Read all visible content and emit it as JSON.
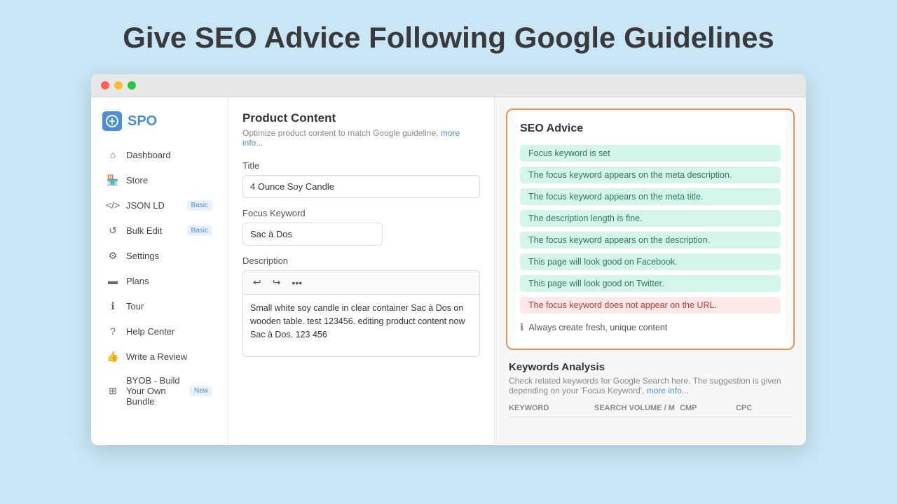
{
  "page": {
    "title": "Give SEO Advice Following Google Guidelines"
  },
  "browser": {
    "traffic_lights": [
      "red",
      "yellow",
      "green"
    ]
  },
  "sidebar": {
    "logo_text": "SPO",
    "items": [
      {
        "id": "dashboard",
        "label": "Dashboard",
        "icon": "home",
        "badge": null
      },
      {
        "id": "store",
        "label": "Store",
        "icon": "store",
        "badge": null
      },
      {
        "id": "json-ld",
        "label": "JSON LD",
        "icon": "code",
        "badge": "Basic"
      },
      {
        "id": "bulk-edit",
        "label": "Bulk Edit",
        "icon": "edit",
        "badge": "Basic"
      },
      {
        "id": "settings",
        "label": "Settings",
        "icon": "gear",
        "badge": null
      },
      {
        "id": "plans",
        "label": "Plans",
        "icon": "card",
        "badge": null
      },
      {
        "id": "tour",
        "label": "Tour",
        "icon": "info-circle",
        "badge": null
      },
      {
        "id": "help-center",
        "label": "Help Center",
        "icon": "help-circle",
        "badge": null
      },
      {
        "id": "write-review",
        "label": "Write a Review",
        "icon": "thumb-up",
        "badge": null
      },
      {
        "id": "byob",
        "label": "BYOB - Build Your Own Bundle",
        "icon": "bundle",
        "badge": "New"
      }
    ]
  },
  "product_panel": {
    "title": "Product Content",
    "subtitle": "Optimize product content to match Google guideline,",
    "more_info_link": "more info...",
    "title_label": "Title",
    "title_value": "4 Ounce Soy Candle",
    "keyword_label": "Focus Keyword",
    "keyword_value": "Sac à Dos",
    "description_label": "Description",
    "description_text": "Small white soy candle in clear container Sac à Dos on wooden table. test 123456. editing product content now Sac à Dos. 123 456",
    "toolbar_undo": "↩",
    "toolbar_redo": "↪",
    "toolbar_more": "•••"
  },
  "seo_panel": {
    "title": "SEO Advice",
    "advice_items": [
      {
        "text": "Focus keyword is set",
        "type": "green"
      },
      {
        "text": "The focus keyword appears on the meta description.",
        "type": "green"
      },
      {
        "text": "The focus keyword appears on the meta title.",
        "type": "green"
      },
      {
        "text": "The description length is fine.",
        "type": "green"
      },
      {
        "text": "The focus keyword appears on the description.",
        "type": "green"
      },
      {
        "text": "This page will look good on Facebook.",
        "type": "green"
      },
      {
        "text": "This page will look good on Twitter.",
        "type": "green"
      },
      {
        "text": "The focus keyword does not appear on the URL.",
        "type": "red"
      }
    ],
    "info_text": "Always create fresh, unique content"
  },
  "keywords_section": {
    "title": "Keywords Analysis",
    "subtitle": "Check related keywords for Google Search here. The suggestion is given depending on your 'Focus Keyword',",
    "more_info_link": "more info...",
    "table_headers": [
      "KEYWORD",
      "SEARCH VOLUME / M",
      "CMP",
      "CPC"
    ]
  }
}
